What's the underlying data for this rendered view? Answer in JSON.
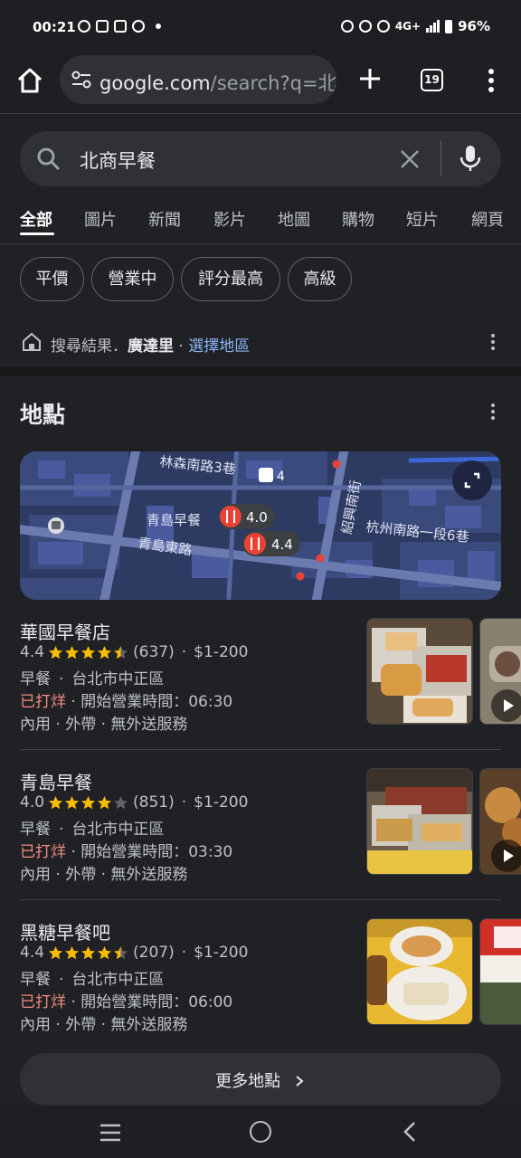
{
  "status_bar": {
    "time": "00:21",
    "network": "4G+",
    "battery": "96%"
  },
  "browser": {
    "url_main": "google.com",
    "url_rest": "/search?q=北i",
    "tab_count": "19"
  },
  "search": {
    "query": "北商早餐"
  },
  "tabs": [
    "全部",
    "圖片",
    "新聞",
    "影片",
    "地圖",
    "購物",
    "短片",
    "網頁"
  ],
  "chips": [
    "平價",
    "營業中",
    "評分最高",
    "高級"
  ],
  "location": {
    "prefix": "搜尋結果．",
    "area": "廣達里",
    "sep": " · ",
    "link": "選擇地區"
  },
  "places_section": {
    "title": "地點"
  },
  "map": {
    "labels": {
      "street1": "林森南路3巷",
      "street2": "紹興南街",
      "street3": "青島東路",
      "street4": "杭州南路一段6巷",
      "bus_badge": "4",
      "pin1_name": "青島早餐",
      "pin1_rating": "4.0",
      "pin2_rating": "4.4"
    }
  },
  "places": [
    {
      "name": "華國早餐店",
      "rating": "4.4",
      "stars": 4.5,
      "reviews": "(637)",
      "price": "$1-200",
      "category": "早餐",
      "district": "台北市中正區",
      "status": "已打烊",
      "opens": "開始營業時間：06:30",
      "service": "內用 · 外帶 · 無外送服務"
    },
    {
      "name": "青島早餐",
      "rating": "4.0",
      "stars": 4,
      "reviews": "(851)",
      "price": "$1-200",
      "category": "早餐",
      "district": "台北市中正區",
      "status": "已打烊",
      "opens": "開始營業時間：03:30",
      "service": "內用 · 外帶 · 無外送服務"
    },
    {
      "name": "黑糖早餐吧",
      "rating": "4.4",
      "stars": 4.5,
      "reviews": "(207)",
      "price": "$1-200",
      "category": "早餐",
      "district": "台北市中正區",
      "status": "已打烊",
      "opens": "開始營業時間：06:00",
      "service": "內用 · 外帶 · 無外送服務"
    }
  ],
  "more_button": {
    "label": "更多地點"
  },
  "colors": {
    "closed": "#f28b82",
    "star": "#fbbc04",
    "link": "#8ab4f8",
    "pin": "#ea4335"
  }
}
